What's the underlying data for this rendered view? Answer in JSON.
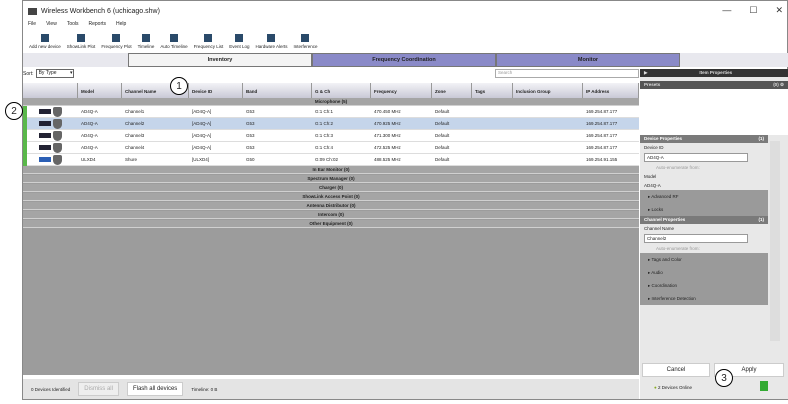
{
  "window": {
    "title": "Wireless Workbench 6 (uchicago.shw)",
    "controls": [
      "—",
      "☐",
      "✕"
    ]
  },
  "menu": [
    "File",
    "View",
    "Tools",
    "Reports",
    "Help"
  ],
  "toolbar": [
    "Add new device",
    "ShowLink Plot",
    "Frequency Plot",
    "Timeline",
    "Auto Timeline",
    "Frequency List",
    "Event Log",
    "Hardware Alerts",
    "Interference"
  ],
  "tabs": [
    "Inventory",
    "Frequency Coordination",
    "Monitor"
  ],
  "sort": {
    "label": "Sort:",
    "value": "By Type"
  },
  "search": {
    "placeholder": "Search"
  },
  "columns": [
    "Model",
    "Channel Name",
    "Device ID",
    "Band",
    "G & Ch",
    "Frequency",
    "Zone",
    "Tags",
    "Inclusion Group",
    "IP Address"
  ],
  "group_microphone": "Microphone (5)",
  "rows": [
    [
      "AD4Q-A",
      "Channel1",
      "[AD4Q-A]",
      "G53",
      "G:1 Ch:1",
      "470.450 MHz",
      "Default",
      "",
      "",
      "169.254.87.177"
    ],
    [
      "AD4Q-A",
      "Channel2",
      "[AD4Q-A]",
      "G53",
      "G:1 Ch:2",
      "470.925 MHz",
      "Default",
      "",
      "",
      "169.254.87.177"
    ],
    [
      "AD4Q-A",
      "Channel3",
      "[AD4Q-A]",
      "G53",
      "G:1 Ch:3",
      "471.300 MHz",
      "Default",
      "",
      "",
      "169.254.87.177"
    ],
    [
      "AD4Q-A",
      "Channel4",
      "[AD4Q-A]",
      "G53",
      "G:1 Ch:4",
      "472.525 MHz",
      "Default",
      "",
      "",
      "169.254.87.177"
    ],
    [
      "ULXD4",
      "Shure",
      "[ULXD4]",
      "G50",
      "G:09 Ch:02",
      "488.525 MHz",
      "Default",
      "",
      "",
      "169.254.91.155"
    ]
  ],
  "groups": [
    "In Ear Monitor (0)",
    "Spectrum Manager (0)",
    "Charger (0)",
    "ShowLink Access Point (0)",
    "Antenna Distributor (0)",
    "Intercom (0)",
    "Other Equipment (0)"
  ],
  "status": {
    "identified": "0 Devices Identified",
    "dismiss": "Dismiss all",
    "flash": "Flash all devices",
    "timeline": "Timeline: 0 B"
  },
  "panel": {
    "title": "Item Properties",
    "presets": "Presets",
    "presets_count": "(0)",
    "device_props": "Device Properties",
    "device_count": "(1)",
    "device_id_label": "Device ID",
    "device_id": "AD4Q-A",
    "auto_enum": "Auto-enumerate from:",
    "model_label": "Model",
    "model": "AD4Q-A",
    "device_subs": [
      "Advanced RF",
      "Locks"
    ],
    "channel_props": "Channel Properties",
    "channel_count": "(1)",
    "channel_name_label": "Channel Name",
    "channel_name": "Channel2",
    "channel_subs": [
      "Tags and Color",
      "Audio",
      "Coordination",
      "Interference Detection"
    ],
    "cancel": "Cancel",
    "apply": "Apply",
    "online": "2 Devices Online"
  },
  "callouts": [
    "1",
    "2",
    "3"
  ],
  "colors": {
    "selected_row": "#c5d5ea",
    "online_bar": "#5ab84a",
    "active_tab": "#f4f4f4",
    "inactive_tab": "#8a8ac8"
  }
}
